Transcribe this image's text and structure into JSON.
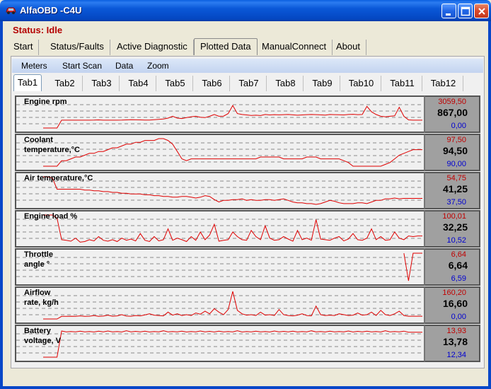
{
  "window": {
    "title": "AlfaOBD -C4U",
    "buttons": [
      "minimize",
      "maximize",
      "close"
    ]
  },
  "status": "Status: Idle",
  "main_nav": [
    {
      "label": "Start",
      "active": false
    },
    {
      "label": "Status/Faults",
      "active": false
    },
    {
      "label": "Active Diagnostic",
      "active": false
    },
    {
      "label": "Plotted Data",
      "active": true
    },
    {
      "label": "ManualConnect",
      "active": false
    },
    {
      "label": "About",
      "active": false
    }
  ],
  "submenu": [
    "Meters",
    "Start Scan",
    "Data",
    "Zoom"
  ],
  "tabs": [
    "Tab1",
    "Tab2",
    "Tab3",
    "Tab4",
    "Tab5",
    "Tab6",
    "Tab7",
    "Tab8",
    "Tab9",
    "Tab10",
    "Tab11",
    "Tab12"
  ],
  "active_tab": "Tab1",
  "colors": {
    "trace": "#E00000",
    "max": "#C00000",
    "min": "#0000D0",
    "title_bar": "#0A58D8"
  },
  "chart_data": [
    {
      "type": "line",
      "title": "Engine rpm",
      "max": "3059,50",
      "current": "867,00",
      "min": "0,00",
      "y": [
        0,
        0,
        0,
        0,
        868,
        868,
        868,
        868,
        868,
        868,
        868,
        880,
        900,
        870,
        868,
        870,
        872,
        880,
        900,
        920,
        910,
        900,
        880,
        890,
        920,
        960,
        1000,
        1100,
        1300,
        1100,
        1050,
        1150,
        1250,
        1300,
        1200,
        1150,
        1300,
        1500,
        1300,
        1320,
        1600,
        2500,
        1600,
        1500,
        1450,
        1400,
        1420,
        1380,
        1500,
        1450,
        1480,
        1460,
        1480,
        1500,
        1460,
        1420,
        1450,
        1480,
        1500,
        1480,
        1460,
        1430,
        1500,
        1480,
        1470,
        1450,
        1500,
        1520,
        1480,
        1500,
        2400,
        1800,
        1500,
        1300,
        1250,
        1300,
        1350,
        2300,
        1300,
        900,
        868,
        868,
        867
      ]
    },
    {
      "type": "line",
      "title": "Coolant\ntemperature,°C",
      "max": "97,50",
      "current": "94,50",
      "min": "90,00",
      "y": [
        90,
        90,
        90,
        90,
        91.5,
        91.5,
        92,
        92.5,
        92.5,
        93,
        93.5,
        93.5,
        94,
        94,
        94.5,
        95,
        95,
        95.5,
        96,
        96,
        96.5,
        96.5,
        97,
        97,
        97,
        97.5,
        97.5,
        97,
        96,
        94,
        92,
        91.5,
        92,
        92,
        92,
        92,
        92,
        92,
        92,
        92,
        92,
        92,
        92,
        92,
        92,
        92,
        92,
        92.5,
        92.5,
        92.5,
        92.5,
        92.5,
        92,
        92,
        92,
        92,
        92,
        92.5,
        92.5,
        92.5,
        92,
        92,
        92,
        92,
        92,
        91.5,
        91,
        90,
        90,
        90,
        90,
        90,
        90,
        90,
        90.5,
        91,
        92,
        93,
        93.5,
        94,
        94.5,
        94.5,
        94.5
      ]
    },
    {
      "type": "line",
      "title": "Air temperature,°C",
      "max": "54,75",
      "current": "41,25",
      "min": "37,50",
      "y": [
        54.75,
        54.75,
        54,
        47,
        47,
        47,
        47,
        47,
        47,
        46.5,
        46.5,
        46,
        46,
        45.5,
        45.5,
        45,
        45,
        44.5,
        44.5,
        44,
        44,
        44,
        43.5,
        43.5,
        43,
        43,
        42.5,
        42.5,
        42,
        42,
        42.5,
        42.5,
        42,
        41.5,
        42,
        43,
        42.5,
        40.5,
        39,
        40,
        40,
        40.5,
        40.5,
        41,
        40,
        40.5,
        40,
        40,
        40.5,
        40.5,
        40,
        40.5,
        41,
        40,
        39,
        38.5,
        38.5,
        38,
        38,
        37.5,
        38,
        39,
        40,
        39.5,
        38.5,
        38,
        38,
        38,
        38.5,
        38.5,
        38,
        39,
        40,
        40,
        41,
        41,
        41.5,
        41,
        41.25,
        41.25,
        41.25,
        41.25,
        41.25
      ]
    },
    {
      "type": "line",
      "title": "Engine load %",
      "max": "100,01",
      "current": "32,25",
      "min": "10,52",
      "y": [
        100,
        100,
        100,
        90,
        20,
        18,
        15,
        25,
        12,
        14,
        20,
        16,
        30,
        18,
        15,
        20,
        14,
        25,
        18,
        22,
        16,
        40,
        18,
        14,
        30,
        16,
        20,
        55,
        18,
        25,
        20,
        14,
        30,
        18,
        45,
        20,
        35,
        70,
        15,
        18,
        20,
        45,
        30,
        20,
        18,
        50,
        30,
        20,
        65,
        25,
        18,
        20,
        30,
        22,
        15,
        50,
        20,
        25,
        18,
        85,
        22,
        20,
        18,
        25,
        30,
        16,
        22,
        40,
        20,
        18,
        25,
        55,
        20,
        30,
        18,
        20,
        45,
        25,
        20,
        32,
        30,
        32,
        32
      ]
    },
    {
      "type": "line",
      "title": "Throttle\nangle °",
      "max": "6,64",
      "current": "6,64",
      "min": "6,59",
      "y": [
        null,
        null,
        null,
        null,
        null,
        null,
        null,
        null,
        null,
        null,
        null,
        null,
        null,
        null,
        null,
        null,
        null,
        null,
        null,
        null,
        null,
        null,
        null,
        null,
        null,
        null,
        null,
        null,
        null,
        null,
        null,
        null,
        null,
        null,
        null,
        null,
        null,
        null,
        null,
        null,
        null,
        null,
        null,
        null,
        null,
        null,
        null,
        null,
        null,
        null,
        null,
        null,
        null,
        null,
        null,
        null,
        null,
        null,
        null,
        null,
        null,
        null,
        null,
        null,
        null,
        null,
        null,
        null,
        null,
        null,
        null,
        null,
        null,
        null,
        null,
        null,
        null,
        null,
        6.64,
        6.59,
        6.64,
        6.64,
        6.64
      ]
    },
    {
      "type": "line",
      "title": "Airflow\nrate, kg/h",
      "max": "160,20",
      "current": "16,60",
      "min": "0,00",
      "y": [
        0,
        0,
        0,
        0,
        15,
        15,
        16,
        15,
        18,
        15,
        16,
        20,
        15,
        17,
        22,
        16,
        18,
        25,
        17,
        16,
        20,
        18,
        24,
        30,
        22,
        20,
        18,
        40,
        22,
        30,
        20,
        25,
        20,
        35,
        28,
        45,
        30,
        60,
        40,
        25,
        55,
        160,
        50,
        30,
        22,
        25,
        20,
        40,
        22,
        25,
        20,
        55,
        25,
        20,
        18,
        22,
        30,
        20,
        18,
        75,
        25,
        20,
        22,
        20,
        30,
        25,
        20,
        22,
        35,
        22,
        25,
        40,
        20,
        50,
        25,
        20,
        30,
        45,
        20,
        16,
        16,
        16,
        16
      ]
    },
    {
      "type": "line",
      "title": "Battery\nvoltage, V",
      "max": "13,93",
      "current": "13,78",
      "min": "12,34",
      "y": [
        12.34,
        12.34,
        12.34,
        12.34,
        13.85,
        13.8,
        13.82,
        13.8,
        13.84,
        13.8,
        13.82,
        13.79,
        13.84,
        13.8,
        13.85,
        13.8,
        13.82,
        13.79,
        13.86,
        13.8,
        13.83,
        13.8,
        13.84,
        13.79,
        13.82,
        13.8,
        13.86,
        13.8,
        13.82,
        13.8,
        13.84,
        13.79,
        13.82,
        13.8,
        13.85,
        13.8,
        13.83,
        13.79,
        13.84,
        13.8,
        13.82,
        13.8,
        13.86,
        13.79,
        13.82,
        13.8,
        13.84,
        13.8,
        13.82,
        13.79,
        13.85,
        13.8,
        13.83,
        13.8,
        13.84,
        13.79,
        13.82,
        13.8,
        13.86,
        13.8,
        13.82,
        13.79,
        13.84,
        13.8,
        13.82,
        13.8,
        13.85,
        13.79,
        13.83,
        13.8,
        13.84,
        13.8,
        13.82,
        13.79,
        13.86,
        13.8,
        13.82,
        13.8,
        13.84,
        13.78,
        13.78,
        13.78,
        13.78
      ]
    }
  ]
}
